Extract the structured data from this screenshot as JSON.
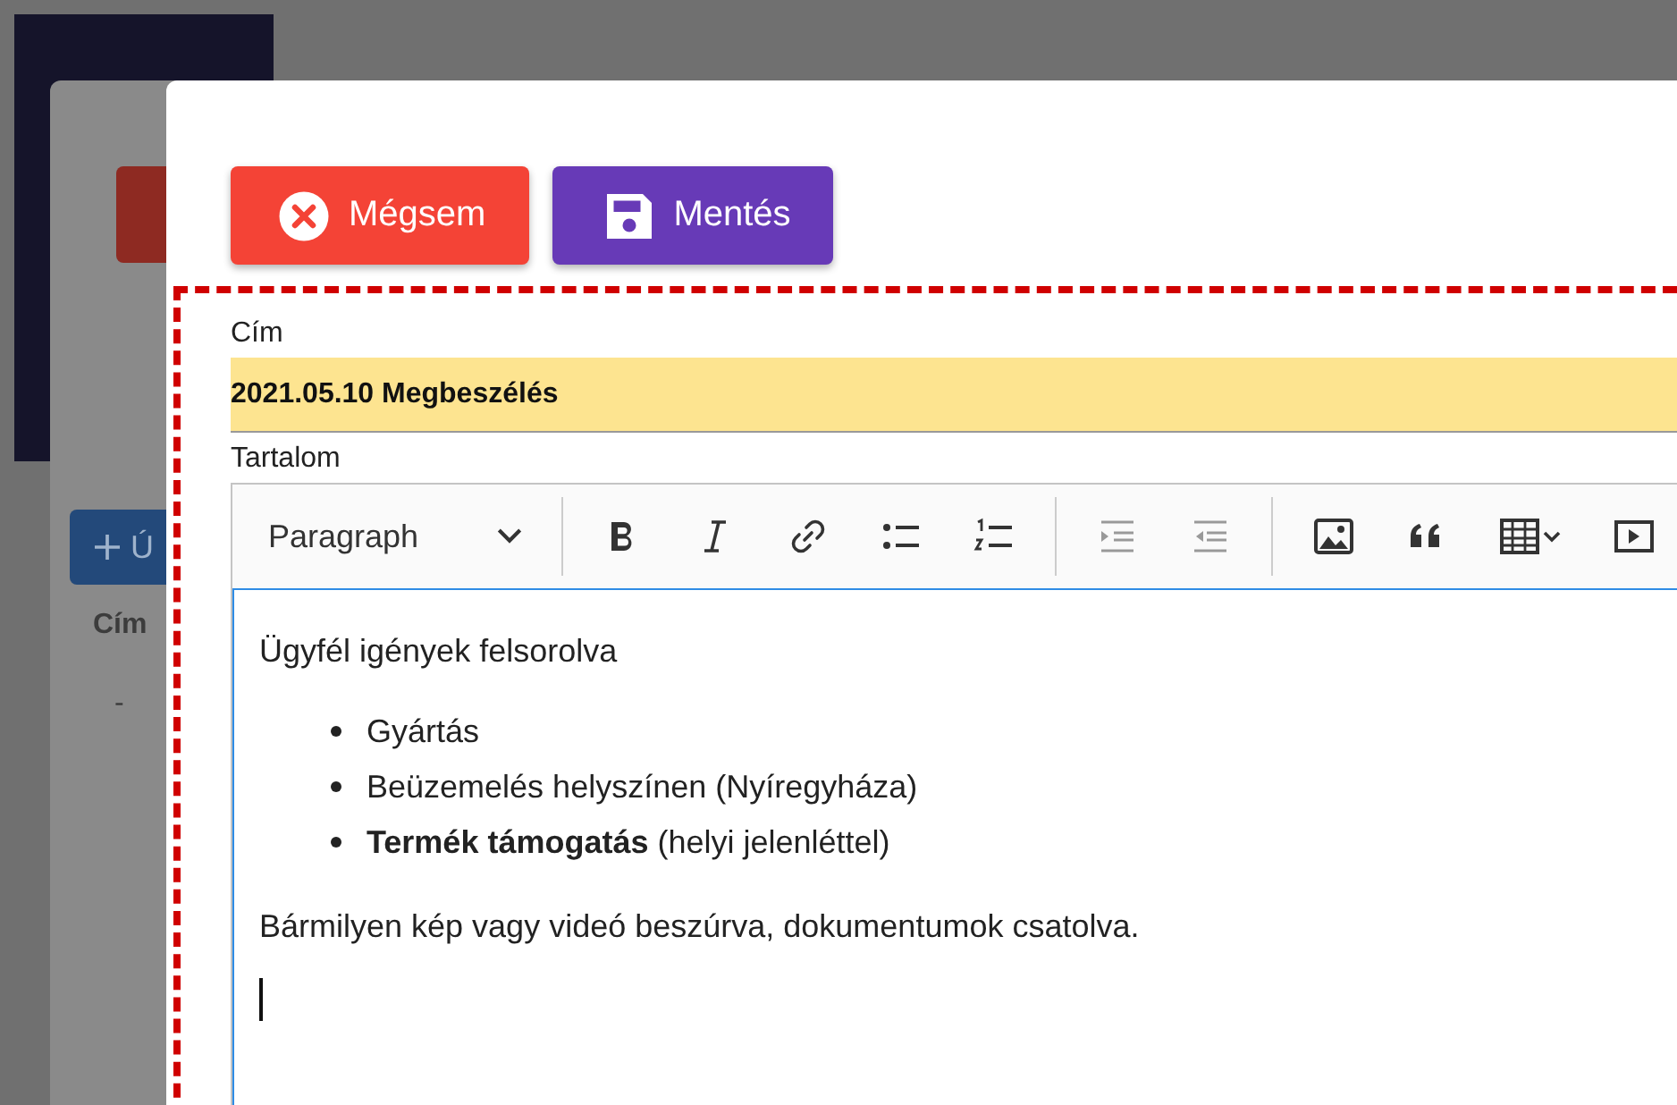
{
  "background_page": {
    "new_button": "Ú",
    "table_header": "Cím",
    "table_cell": "-"
  },
  "dialog": {
    "buttons": [
      {
        "kind": "cancel",
        "label": "Mégsem"
      },
      {
        "kind": "save",
        "label": "Mentés"
      }
    ],
    "title_field": {
      "label": "Cím",
      "value": "2021.05.10 Megbeszélés"
    },
    "content_label": "Tartalom",
    "toolbar": {
      "heading_select": "Paragraph",
      "tools": [
        {
          "kind": "bold",
          "disabled": false
        },
        {
          "kind": "italic",
          "disabled": false
        },
        {
          "kind": "link",
          "disabled": false
        },
        {
          "kind": "bulleted-list",
          "disabled": false
        },
        {
          "kind": "numbered-list",
          "disabled": false
        },
        {
          "kind": "indent",
          "disabled": true
        },
        {
          "kind": "outdent",
          "disabled": true
        },
        {
          "kind": "image",
          "disabled": false
        },
        {
          "kind": "quote",
          "disabled": false
        },
        {
          "kind": "table",
          "disabled": false
        },
        {
          "kind": "media",
          "disabled": false
        }
      ]
    },
    "content": [
      {
        "kind": "paragraph",
        "text": "Ügyfél igények felsorolva"
      },
      {
        "kind": "list",
        "items": [
          "Gyártás",
          "Beüzemelés helyszínen (Nyíregyháza)",
          "**Termék támogatás** (helyi jelenléttel)"
        ]
      },
      {
        "kind": "paragraph",
        "text": "Bármilyen kép vagy videó beszúrva, dokumentumok csatolva."
      }
    ]
  }
}
